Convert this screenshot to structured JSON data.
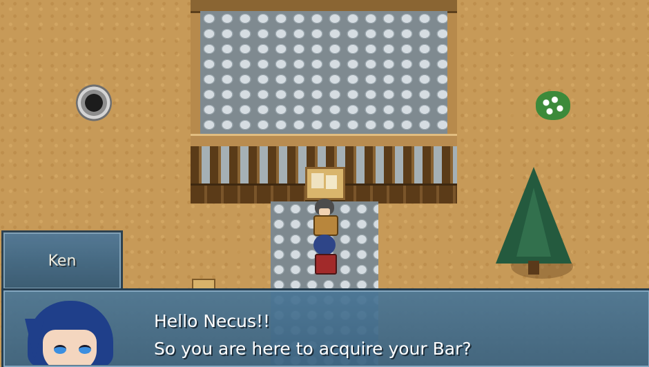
{
  "dialog": {
    "speaker": "Ken",
    "lines": [
      "Hello Necus!!",
      "So you are here to acquire your Bar?"
    ]
  },
  "colors": {
    "ground": "#c79a58",
    "window": "#4a7696",
    "window_border": "#253d4f",
    "text": "#ffffff"
  }
}
